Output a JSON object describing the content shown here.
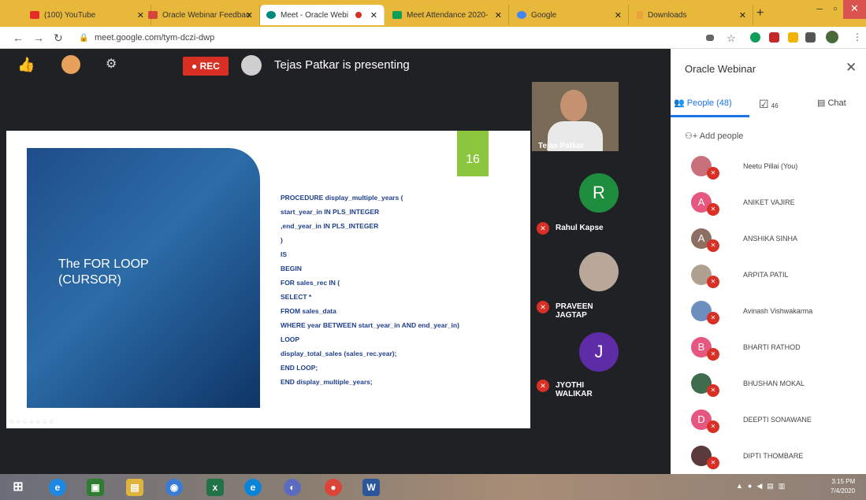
{
  "browser": {
    "tabs": [
      {
        "title": "(100) YouTube",
        "color": "#e52d27"
      },
      {
        "title": "Oracle Webinar Feedbac",
        "color": "#d44638"
      },
      {
        "title": "Meet - Oracle Webi",
        "color": "#00897b"
      },
      {
        "title": "Meet Attendance 2020-",
        "color": "#0f9d58"
      },
      {
        "title": "Google",
        "color": "#4285f4"
      },
      {
        "title": "Downloads",
        "color": "#e8a33a"
      }
    ],
    "url": "meet.google.com/tym-dczi-dwp"
  },
  "meet": {
    "rec_label": "REC",
    "presenting_text": "Tejas Patkar is presenting",
    "slide": {
      "title_line1": "The FOR LOOP",
      "title_line2": "(CURSOR)",
      "number": "16",
      "code_lines": [
        "PROCEDURE display_multiple_years (",
        " start_year_in IN PLS_INTEGER",
        " ,end_year_in IN PLS_INTEGER",
        ")",
        "IS",
        " BEGIN",
        " FOR sales_rec IN (",
        "   SELECT *",
        "   FROM sales_data",
        "   WHERE year BETWEEN start_year_in AND end_year_in)",
        " LOOP",
        " display_total_sales (sales_rec.year);",
        " END LOOP;",
        "END display_multiple_years;"
      ]
    },
    "tiles": [
      {
        "name": "Tejas Patkar",
        "initial": ""
      },
      {
        "name": "Rahul Kapse",
        "initial": "R",
        "color": "#1e8e3e"
      },
      {
        "name": "PRAVEEN JAGTAP",
        "initial": ""
      },
      {
        "name": "JYOTHI WALIKAR",
        "initial": "J",
        "color": "#5f2ca8"
      }
    ]
  },
  "panel": {
    "title": "Oracle Webinar",
    "tab_people": "People (48)",
    "tab_tasks_count": "46",
    "tab_chat": "Chat",
    "add_people": "Add people",
    "people": [
      {
        "name": "Neetu Pillai (You)",
        "initial": "",
        "color": "#c9707a"
      },
      {
        "name": "ANIKET VAJIRE",
        "initial": "A",
        "color": "#e6577f"
      },
      {
        "name": "ANSHIKA SINHA",
        "initial": "A",
        "color": "#8d6e63"
      },
      {
        "name": "ARPITA PATIL",
        "initial": "",
        "color": "#b0a090"
      },
      {
        "name": "Avinash Vishwakarma",
        "initial": "",
        "color": "#6d8fbf"
      },
      {
        "name": "BHARTI RATHOD",
        "initial": "B",
        "color": "#e6577f"
      },
      {
        "name": "BHUSHAN MOKAL",
        "initial": "",
        "color": "#3f6b4f"
      },
      {
        "name": "DEEPTI SONAWANE",
        "initial": "D",
        "color": "#e6577f"
      },
      {
        "name": "DIPTI THOMBARE",
        "initial": "",
        "color": "#5a3a3a"
      }
    ]
  },
  "taskbar": {
    "time": "3:15 PM",
    "date": "7/4/2020"
  }
}
